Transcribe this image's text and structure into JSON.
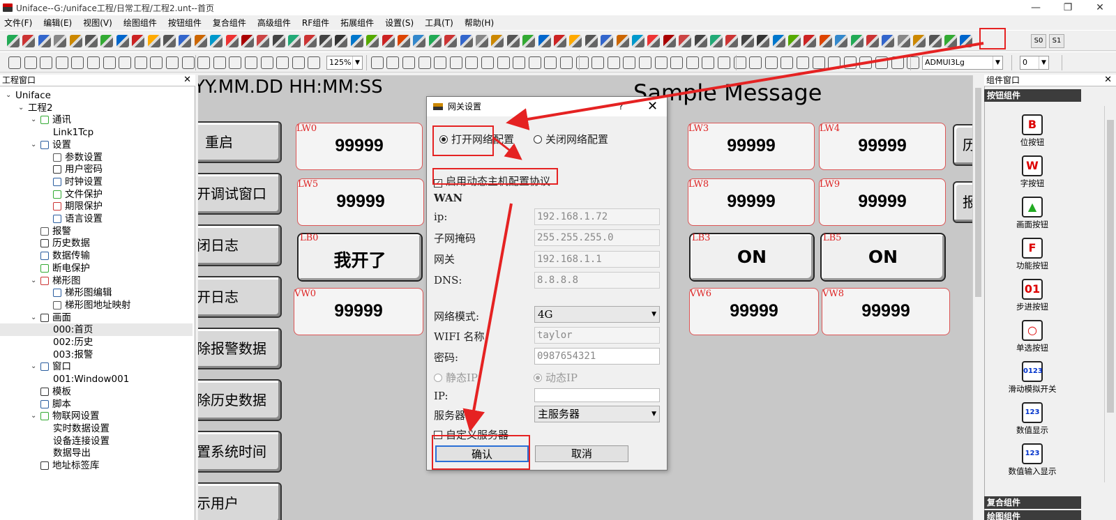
{
  "window": {
    "title": "Uniface--G:/uniface工程/日常工程/工程2.unt--首页",
    "min": "—",
    "max": "❐",
    "close": "✕"
  },
  "menu": [
    "文件(F)",
    "编辑(E)",
    "视图(V)",
    "绘图组件",
    "按钮组件",
    "复合组件",
    "高级组件",
    "RF组件",
    "拓展组件",
    "设置(S)",
    "工具(T)",
    "帮助(H)"
  ],
  "toolbar": {
    "zoom": "125%",
    "font": "ADMUI3Lg",
    "size": "0",
    "s0": "S0",
    "s1": "S1",
    "more": "»"
  },
  "project_panel": {
    "title": "工程窗口",
    "close": "✕",
    "tree": [
      {
        "label": "Uniface",
        "level": 0,
        "arrow": "⌄"
      },
      {
        "label": "工程2",
        "level": 1,
        "arrow": "⌄"
      },
      {
        "label": "通讯",
        "level": 2,
        "arrow": "⌄"
      },
      {
        "label": "Link1Tcp",
        "level": 3,
        "arrow": ""
      },
      {
        "label": "设置",
        "level": 2,
        "arrow": "⌄"
      },
      {
        "label": "参数设置",
        "level": 3,
        "arrow": ""
      },
      {
        "label": "用户密码",
        "level": 3,
        "arrow": ""
      },
      {
        "label": "时钟设置",
        "level": 3,
        "arrow": ""
      },
      {
        "label": "文件保护",
        "level": 3,
        "arrow": ""
      },
      {
        "label": "期限保护",
        "level": 3,
        "arrow": ""
      },
      {
        "label": "语言设置",
        "level": 3,
        "arrow": ""
      },
      {
        "label": "报警",
        "level": 2,
        "arrow": ""
      },
      {
        "label": "历史数据",
        "level": 2,
        "arrow": ""
      },
      {
        "label": "数据传输",
        "level": 2,
        "arrow": ""
      },
      {
        "label": "断电保护",
        "level": 2,
        "arrow": ""
      },
      {
        "label": "梯形图",
        "level": 2,
        "arrow": "⌄"
      },
      {
        "label": "梯形图编辑",
        "level": 3,
        "arrow": ""
      },
      {
        "label": "梯形图地址映射",
        "level": 3,
        "arrow": ""
      },
      {
        "label": "画面",
        "level": 2,
        "arrow": "⌄"
      },
      {
        "label": "000:首页",
        "level": 3,
        "arrow": "",
        "selected": true
      },
      {
        "label": "002:历史",
        "level": 3,
        "arrow": ""
      },
      {
        "label": "003:报警",
        "level": 3,
        "arrow": ""
      },
      {
        "label": "窗口",
        "level": 2,
        "arrow": "⌄"
      },
      {
        "label": "001:Window001",
        "level": 3,
        "arrow": ""
      },
      {
        "label": "模板",
        "level": 2,
        "arrow": ""
      },
      {
        "label": "脚本",
        "level": 2,
        "arrow": ""
      },
      {
        "label": "物联网设置",
        "level": 2,
        "arrow": "⌄"
      },
      {
        "label": "实时数据设置",
        "level": 3,
        "arrow": ""
      },
      {
        "label": "设备连接设置",
        "level": 3,
        "arrow": ""
      },
      {
        "label": "数据导出",
        "level": 3,
        "arrow": ""
      },
      {
        "label": "地址标签库",
        "level": 2,
        "arrow": ""
      }
    ]
  },
  "canvas": {
    "clock": "YY.MM.DD  HH:MM:SS",
    "message": "Sample Message",
    "left_buttons": [
      "重启",
      "打开调试窗口",
      "关闭日志",
      "打开日志",
      "清除报警数据",
      "清除历史数据",
      "设置系统时间",
      "显示用户"
    ],
    "right_partial": [
      "历",
      "报"
    ],
    "row1": [
      {
        "tag": "LW0",
        "val": "99999"
      },
      {
        "tag": "LW3",
        "val": "99999"
      },
      {
        "tag": "LW4",
        "val": "99999"
      }
    ],
    "row2": [
      {
        "tag": "LW5",
        "val": "99999"
      },
      {
        "tag": "LW8",
        "val": "99999"
      },
      {
        "tag": "LW9",
        "val": "99999"
      }
    ],
    "row3": [
      {
        "tag": "LB0",
        "val": "我开了"
      },
      {
        "tag": "LB3",
        "val": "ON"
      },
      {
        "tag": "LB5",
        "val": "ON"
      }
    ],
    "row4": [
      {
        "tag": "VW0",
        "val": "99999"
      },
      {
        "tag": "VW6",
        "val": "99999"
      },
      {
        "tag": "VW8",
        "val": "99999"
      }
    ]
  },
  "component_panel": {
    "title": "组件窗口",
    "close": "✕",
    "header": "按钮组件",
    "items": [
      {
        "label": "位按钮",
        "glyph": "B"
      },
      {
        "label": "字按钮",
        "glyph": "W"
      },
      {
        "label": "画面按钮",
        "glyph": "▲"
      },
      {
        "label": "功能按钮",
        "glyph": "F"
      },
      {
        "label": "步进按钮",
        "glyph": "01"
      },
      {
        "label": "单选按钮",
        "glyph": "○"
      },
      {
        "label": "滑动模拟开关",
        "glyph": "0123"
      },
      {
        "label": "数值显示",
        "glyph": "123"
      },
      {
        "label": "数值输入显示",
        "glyph": "123"
      }
    ],
    "footer1": "复合组件",
    "footer2": "绘图组件"
  },
  "dialog": {
    "title": "网关设置",
    "help": "?",
    "close": "✕",
    "open_net": "打开网络配置",
    "close_net": "关闭网络配置",
    "dhcp": "启用动态主机配置协议",
    "wan": "WAN",
    "ip_label": "ip:",
    "ip": "192.168.1.72",
    "mask_label": "子网掩码",
    "mask": "255.255.255.0",
    "gw_label": "网关",
    "gw": "192.168.1.1",
    "dns_label": "DNS:",
    "dns": "8.8.8.8",
    "mode_label": "网络模式:",
    "mode": "4G",
    "wifi_label": "WIFI 名称",
    "wifi": "taylor",
    "pwd_label": "密码:",
    "pwd": "0987654321",
    "static_ip": "静态IP",
    "dynamic_ip": "动态IP",
    "ip2_label": "IP:",
    "ip2": "",
    "server_label": "服务器",
    "server": "主服务器",
    "custom_server": "自定义服务器",
    "ok": "确认",
    "cancel": "取消"
  },
  "annotation_color": "#e52222"
}
